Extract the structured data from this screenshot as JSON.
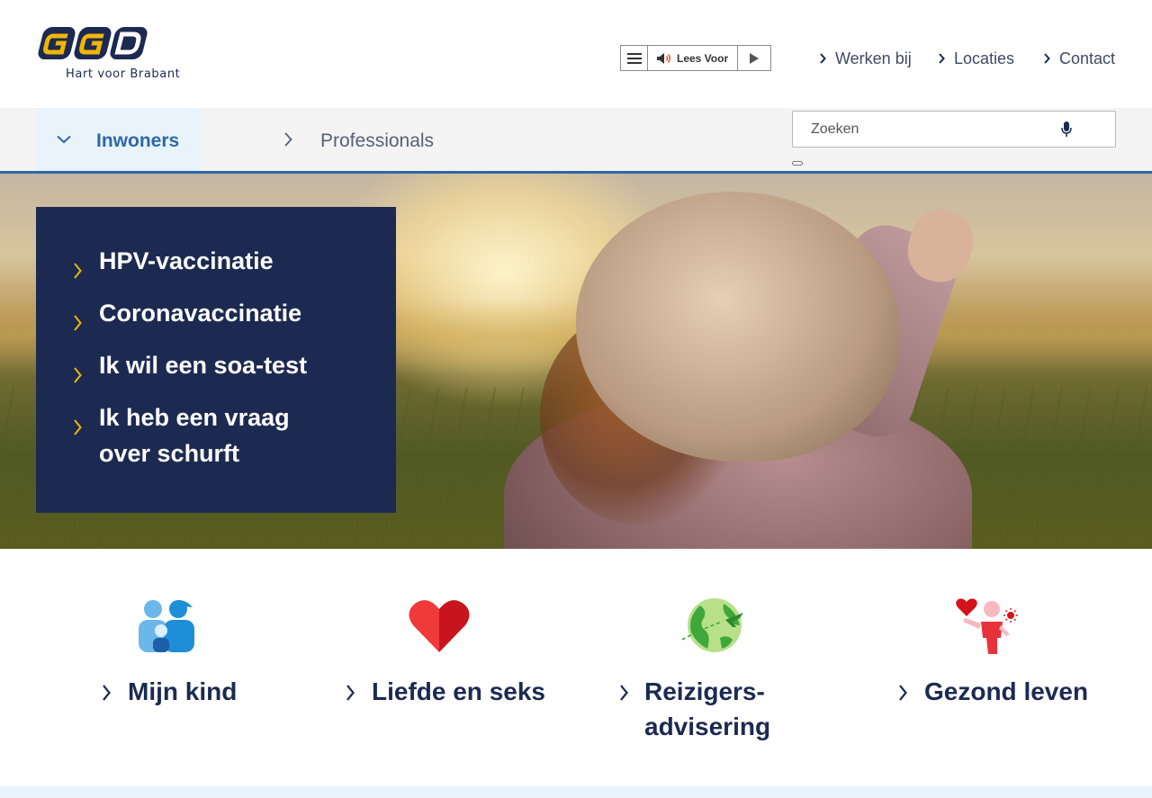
{
  "brand": {
    "logo_letters": "GGD",
    "tagline": "Hart voor Brabant",
    "colors": {
      "navy": "#1c2a52",
      "blue": "#2f67a9",
      "light_blue": "#e8f3fc",
      "yellow": "#f2b600"
    }
  },
  "readspeaker": {
    "menu_icon": "hamburger-icon",
    "listen_label": "Lees Voor",
    "speaker_icon": "speaker-icon",
    "play_icon": "play-icon"
  },
  "topnav": {
    "items": [
      {
        "label": "Werken bij",
        "icon": "chevron-right-icon"
      },
      {
        "label": "Locaties",
        "icon": "chevron-right-icon"
      },
      {
        "label": "Contact",
        "icon": "chevron-right-icon"
      }
    ]
  },
  "subnav": {
    "tabs": [
      {
        "label": "Inwoners",
        "active": true,
        "icon": "chevron-down-icon"
      },
      {
        "label": "Professionals",
        "active": false,
        "icon": "chevron-right-icon"
      }
    ]
  },
  "search": {
    "placeholder": "Zoeken",
    "value": "",
    "mic_icon": "microphone-icon"
  },
  "hero": {
    "quick_links": [
      {
        "label": "HPV-vaccinatie"
      },
      {
        "label": "Coronavaccinatie"
      },
      {
        "label": "Ik wil een soa-test"
      },
      {
        "label": "Ik heb een vraag over schurft"
      }
    ]
  },
  "themes": [
    {
      "label": "Mijn kind",
      "icon": "family-icon"
    },
    {
      "label": "Liefde en seks",
      "icon": "heart-icon"
    },
    {
      "label": "Reizigers-advisering",
      "icon": "globe-plane-icon"
    },
    {
      "label": "Gezond leven",
      "icon": "healthy-person-icon"
    }
  ]
}
